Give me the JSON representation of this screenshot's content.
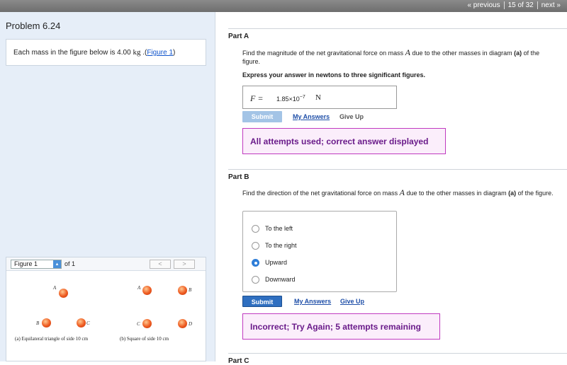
{
  "topbar": {
    "previous": "« previous",
    "position": "15 of 32",
    "next": "next »"
  },
  "problem": {
    "title": "Problem 6.24",
    "statement_prefix": "Each mass in the figure below is 4.00",
    "statement_unit": "kg",
    "statement_mid": " .(",
    "figure_link": "Figure 1",
    "statement_suffix": ")"
  },
  "figure_panel": {
    "select_value": "Figure 1",
    "of_text": "of 1",
    "prev": "<",
    "next": ">",
    "labels": {
      "a1": "A",
      "b1": "B",
      "c1": "C",
      "a2": "A",
      "b2": "B",
      "c2": "C",
      "d2": "D"
    },
    "caption_a": "(a) Equilateral triangle of side 10 cm",
    "caption_b": "(b) Square of side 10 cm"
  },
  "partA": {
    "title": "Part A",
    "question_1": "Find the magnitude of the net gravitational force on mass",
    "mass_var": "A",
    "question_2": "due to the other masses in diagram",
    "question_bold": "(a)",
    "question_3": "of the figure.",
    "instruction": "Express your answer in newtons to three significant figures.",
    "answer_label": "F =",
    "answer_value": "1.85×10",
    "answer_exp": "−7",
    "answer_unit": "N",
    "submit": "Submit",
    "my_answers": "My Answers",
    "give_up": "Give Up",
    "feedback": "All attempts used; correct answer displayed"
  },
  "partB": {
    "title": "Part B",
    "question_1": "Find the direction of the net gravitational force on mass",
    "mass_var": "A",
    "question_2": "due to the other masses in diagram",
    "question_bold": "(a)",
    "question_3": "of the figure.",
    "options": [
      "To the left",
      "To the right",
      "Upward",
      "Downward"
    ],
    "selected": "Upward",
    "submit": "Submit",
    "my_answers": "My Answers",
    "give_up": "Give Up",
    "feedback": "Incorrect; Try Again; 5 attempts remaining"
  },
  "partC": {
    "title": "Part C"
  },
  "colors": {
    "submit_active": "#2f6fc0",
    "submit_disabled": "#a3c4e6",
    "feedback_border": "#c03ac0",
    "feedback_text": "#6a1b8a",
    "link": "#1f4fa8"
  }
}
